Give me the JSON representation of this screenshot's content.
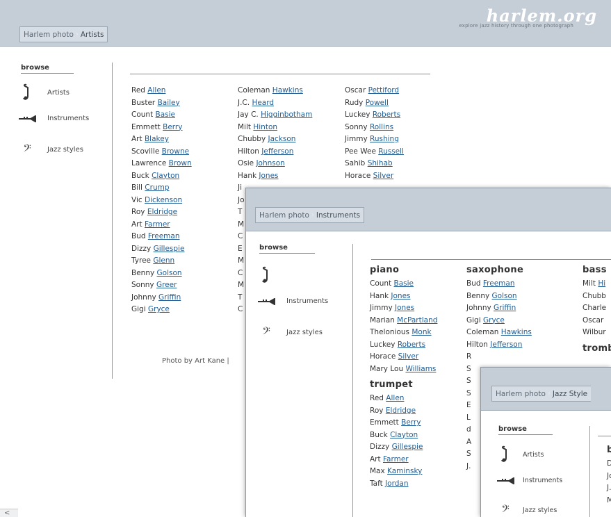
{
  "site": {
    "brand": "harlem.org",
    "tagline": "explore jazz history through one photograph"
  },
  "win1": {
    "breadcrumb": [
      "Harlem photo",
      "Artists"
    ],
    "browse": "browse",
    "nav": [
      "Artists",
      "Instruments",
      "Jazz styles"
    ],
    "col1": [
      [
        "Red ",
        "Allen"
      ],
      [
        "Buster ",
        "Bailey"
      ],
      [
        "Count ",
        "Basie"
      ],
      [
        "Emmett ",
        "Berry"
      ],
      [
        "Art ",
        "Blakey"
      ],
      [
        "Scoville ",
        "Browne"
      ],
      [
        "Lawrence ",
        "Brown"
      ],
      [
        "Buck ",
        "Clayton"
      ],
      [
        "Bill ",
        "Crump"
      ],
      [
        "Vic ",
        "Dickenson"
      ],
      [
        "Roy ",
        "Eldridge"
      ],
      [
        "Art ",
        "Farmer"
      ],
      [
        "Bud ",
        "Freeman"
      ],
      [
        "Dizzy ",
        "Gillespie"
      ],
      [
        "Tyree ",
        "Glenn"
      ],
      [
        "Benny ",
        "Golson"
      ],
      [
        "Sonny ",
        "Greer"
      ],
      [
        "Johnny ",
        "Griffin"
      ],
      [
        "Gigi ",
        "Gryce"
      ]
    ],
    "col2": [
      [
        "Coleman ",
        "Hawkins"
      ],
      [
        "J.C. ",
        "Heard"
      ],
      [
        "Jay C. ",
        "Higginbotham"
      ],
      [
        "Milt ",
        "Hinton"
      ],
      [
        "Chubby ",
        "Jackson"
      ],
      [
        "Hilton ",
        "Jefferson"
      ],
      [
        "Osie ",
        "Johnson"
      ],
      [
        "Hank ",
        "Jones"
      ]
    ],
    "col2_partial": [
      "Ji",
      "Jo",
      "T",
      "M",
      "C",
      "E",
      "M",
      "C",
      "M",
      "T",
      "C"
    ],
    "col3": [
      [
        "Oscar ",
        "Pettiford"
      ],
      [
        "Rudy ",
        "Powell"
      ],
      [
        "Luckey ",
        "Roberts"
      ],
      [
        "Sonny ",
        "Rollins"
      ],
      [
        "Jimmy ",
        "Rushing"
      ],
      [
        "Pee Wee ",
        "Russell"
      ],
      [
        "Sahib ",
        "Shihab"
      ],
      [
        "Horace ",
        "Silver"
      ]
    ],
    "credit": "Photo by Art Kane |",
    "scroll_arrow": "<"
  },
  "win2": {
    "breadcrumb": [
      "Harlem photo",
      "Instruments"
    ],
    "browse": "browse",
    "nav": [
      "Instruments",
      "Jazz styles"
    ],
    "piano": {
      "title": "piano",
      "items": [
        [
          "Count ",
          "Basie"
        ],
        [
          "Hank ",
          "Jones"
        ],
        [
          "Jimmy ",
          "Jones"
        ],
        [
          "Marian ",
          "McPartland"
        ],
        [
          "Thelonious ",
          "Monk"
        ],
        [
          "Luckey ",
          "Roberts"
        ],
        [
          "Horace ",
          "Silver"
        ],
        [
          "Mary Lou ",
          "Williams"
        ]
      ]
    },
    "trumpet": {
      "title": "trumpet",
      "items": [
        [
          "Red ",
          "Allen"
        ],
        [
          "Roy ",
          "Eldridge"
        ],
        [
          "Emmett ",
          "Berry"
        ],
        [
          "Buck ",
          "Clayton"
        ],
        [
          "Dizzy ",
          "Gillespie"
        ],
        [
          "Art ",
          "Farmer"
        ],
        [
          "Max ",
          "Kaminsky"
        ],
        [
          "Taft ",
          "Jordan"
        ]
      ]
    },
    "saxophone": {
      "title": "saxophone",
      "items": [
        [
          "Bud ",
          "Freeman"
        ],
        [
          "Benny ",
          "Golson"
        ],
        [
          "Johnny ",
          "Griffin"
        ],
        [
          "Gigi ",
          "Gryce"
        ],
        [
          "Coleman ",
          "Hawkins"
        ],
        [
          "Hilton ",
          "Jefferson"
        ]
      ],
      "partial": [
        "R",
        "S",
        "S",
        "S",
        "E",
        "L",
        "d",
        "A",
        "S",
        "J."
      ]
    },
    "bass": {
      "title": "bass",
      "items": [
        [
          "Milt ",
          "Hi"
        ],
        [
          "Chubb",
          ""
        ],
        [
          "Charle",
          ""
        ],
        [
          "Oscar ",
          ""
        ],
        [
          "Wilbur",
          ""
        ]
      ],
      "next": "tromb"
    }
  },
  "win3": {
    "breadcrumb": [
      "Harlem photo",
      "Jazz Style"
    ],
    "browse": "browse",
    "nav": [
      "Artists",
      "Instruments",
      "Jazz styles"
    ],
    "heading_partial": "b",
    "rows_partial": [
      "D",
      "Jo",
      "J.",
      "M"
    ]
  }
}
